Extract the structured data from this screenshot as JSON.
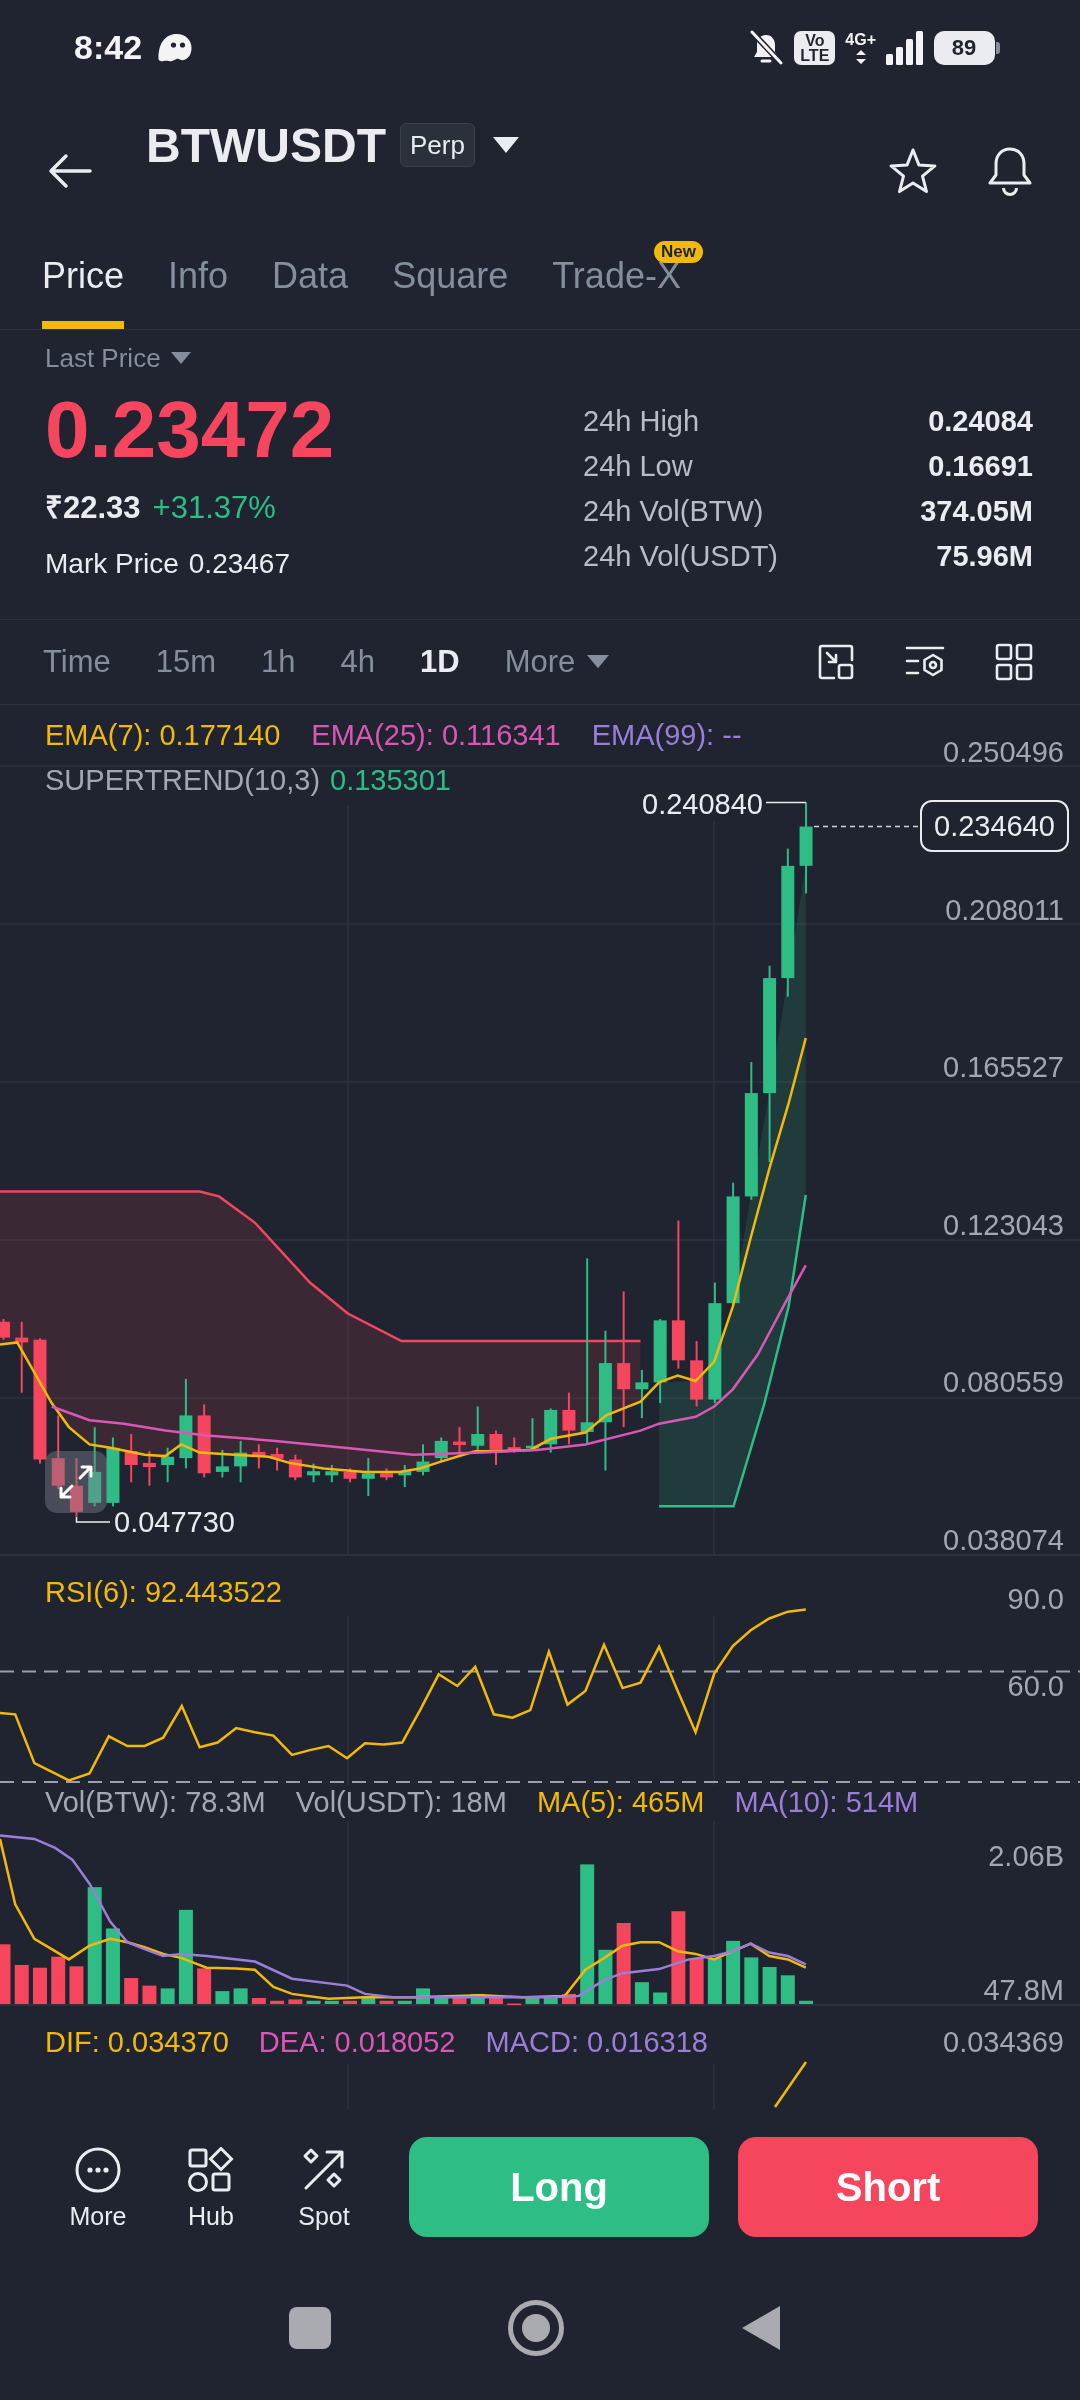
{
  "status_bar": {
    "time": "8:42",
    "network_badge": "Vo LTE",
    "network_type": "4G+",
    "battery": "89"
  },
  "header": {
    "symbol": "BTWUSDT",
    "contract": "Perp"
  },
  "tabs": [
    {
      "label": "Price",
      "selected": true
    },
    {
      "label": "Info",
      "selected": false
    },
    {
      "label": "Data",
      "selected": false
    },
    {
      "label": "Square",
      "selected": false
    },
    {
      "label": "Trade-X",
      "selected": false,
      "badge": "New"
    }
  ],
  "ticker": {
    "price_type": "Last Price",
    "last_price": "0.23472",
    "fiat_price": "₹22.33",
    "change": "+31.37%",
    "mark_price_label": "Mark Price",
    "mark_price": "0.23467",
    "stats": [
      {
        "label": "24h High",
        "value": "0.24084"
      },
      {
        "label": "24h Low",
        "value": "0.16691"
      },
      {
        "label": "24h Vol(BTW)",
        "value": "374.05M"
      },
      {
        "label": "24h Vol(USDT)",
        "value": "75.96M"
      }
    ]
  },
  "intervals": [
    {
      "label": "Time",
      "kind": "interval",
      "selected": false
    },
    {
      "label": "15m",
      "kind": "interval",
      "selected": false
    },
    {
      "label": "1h",
      "kind": "interval",
      "selected": false
    },
    {
      "label": "4h",
      "kind": "interval",
      "selected": false
    },
    {
      "label": "1D",
      "kind": "interval",
      "selected": true
    },
    {
      "label": "More",
      "kind": "menu",
      "selected": false
    }
  ],
  "price_chart": {
    "legend": [
      {
        "label": "EMA(7): 0.177140",
        "color": "#f0b90b"
      },
      {
        "label": "EMA(25): 0.116341",
        "color": "#d957b5"
      },
      {
        "label": "EMA(99): --",
        "color": "#9b7ed8"
      }
    ],
    "supertrend": {
      "label": "SUPERTREND(10,3)",
      "value": "0.135301",
      "color": "#2ebd85"
    },
    "axis": [
      "0.250496",
      "0.208011",
      "0.165527",
      "0.123043",
      "0.080559",
      "0.038074"
    ],
    "high_label": "0.240840",
    "last_price_tag": "0.234640",
    "low_label": "0.047730"
  },
  "rsi": {
    "legend": {
      "label": "RSI(6): 92.443522",
      "color": "#f0b90b"
    },
    "axis": [
      "90.0",
      "60.0"
    ]
  },
  "volume": {
    "legend": [
      {
        "label": "Vol(BTW): 78.3M",
        "color": "#a1a8b3"
      },
      {
        "label": "Vol(USDT): 18M",
        "color": "#a1a8b3"
      },
      {
        "label": "MA(5): 465M",
        "color": "#f0b90b"
      },
      {
        "label": "MA(10): 514M",
        "color": "#9b7ed8"
      }
    ],
    "axis": [
      "2.06B",
      "47.8M"
    ]
  },
  "macd": {
    "legend": [
      {
        "label": "DIF: 0.034370",
        "color": "#f0b90b"
      },
      {
        "label": "DEA: 0.018052",
        "color": "#d957b5"
      },
      {
        "label": "MACD: 0.016318",
        "color": "#9b7ed8"
      }
    ],
    "axis": [
      "0.034369"
    ]
  },
  "actions": [
    {
      "label": "More",
      "kind": "more"
    },
    {
      "label": "Hub",
      "kind": "hub"
    },
    {
      "label": "Spot",
      "kind": "spot"
    }
  ],
  "trade_buttons": [
    {
      "label": "Long",
      "kind": "long"
    },
    {
      "label": "Short",
      "kind": "short"
    }
  ]
}
